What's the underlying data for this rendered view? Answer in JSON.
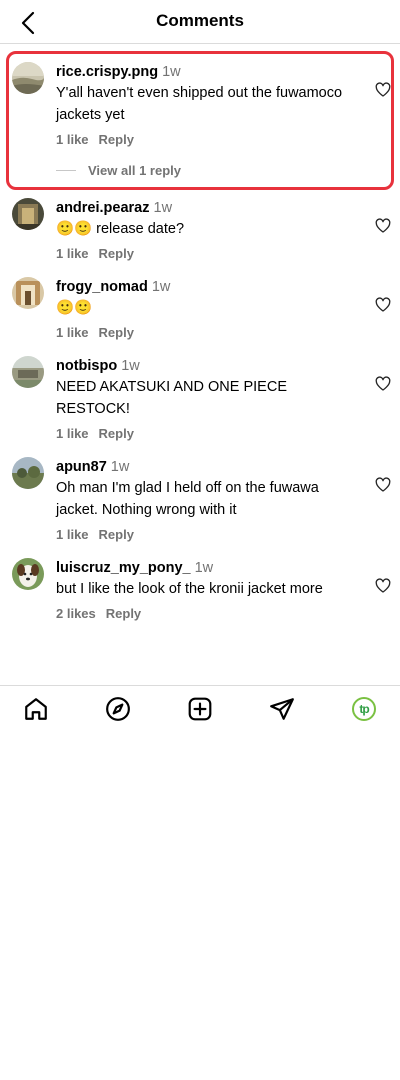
{
  "header": {
    "title": "Comments",
    "back_icon": "chevron-left-icon"
  },
  "comments": [
    {
      "user": "rice.crispy.png",
      "time": "1w",
      "text": "Y'all haven't even shipped out the fuwamoco jackets yet",
      "likes": "1 like",
      "reply": "Reply",
      "view_replies": "View all 1 reply"
    },
    {
      "user": "andrei.pearaz",
      "time": "1w",
      "text": "🙂🙂 release date?",
      "likes": "1 like",
      "reply": "Reply"
    },
    {
      "user": "frogy_nomad",
      "time": "1w",
      "text": "🙂🙂",
      "likes": "1 like",
      "reply": "Reply"
    },
    {
      "user": "notbispo",
      "time": "1w",
      "text": "NEED AKATSUKI AND ONE PIECE RESTOCK!",
      "likes": "1 like",
      "reply": "Reply"
    },
    {
      "user": "apun87",
      "time": "1w",
      "text": "Oh man I'm glad I held off on the fuwawa jacket. Nothing wrong with it",
      "likes": "1 like",
      "reply": "Reply"
    },
    {
      "user": "luiscruz_my_pony_",
      "time": "1w",
      "text": "but I like the look of the kronii jacket more",
      "likes": "2 likes",
      "reply": "Reply"
    }
  ],
  "bottom_nav": {
    "items": [
      "home-icon",
      "explore-icon",
      "create-icon",
      "direct-icon",
      "profile-avatar"
    ],
    "profile_initials": "tp"
  },
  "colors": {
    "highlight": "#e8323c",
    "muted_text": "#737373",
    "profile_ring": "#7ac142"
  }
}
